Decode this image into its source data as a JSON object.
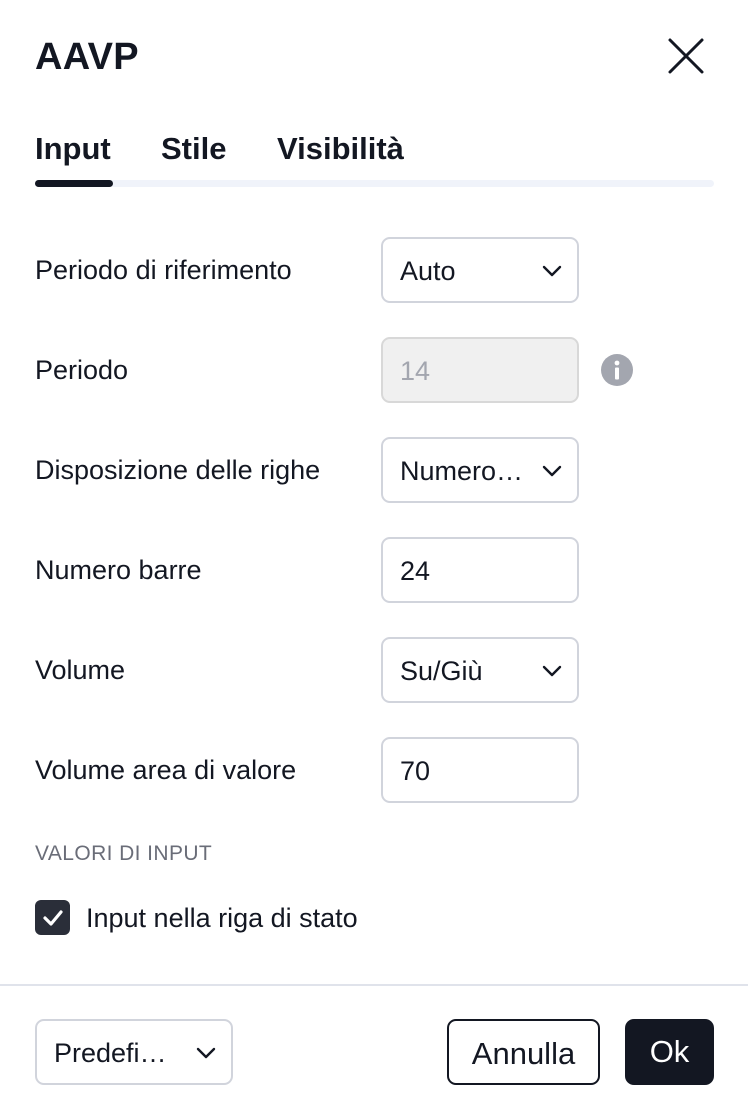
{
  "dialog": {
    "title": "AAVP"
  },
  "tabs": [
    {
      "label": "Input",
      "active": true
    },
    {
      "label": "Stile",
      "active": false
    },
    {
      "label": "Visibilità",
      "active": false
    }
  ],
  "fields": {
    "anchor_period": {
      "label": "Periodo di riferimento",
      "value": "Auto",
      "type": "select"
    },
    "length": {
      "label": "Periodo",
      "value": "14",
      "type": "input",
      "disabled": true
    },
    "rows_layout": {
      "label": "Disposizione delle righe",
      "value": "Numero…",
      "type": "select"
    },
    "row_size": {
      "label": "Numero barre",
      "value": "24",
      "type": "input"
    },
    "volume": {
      "label": "Volume",
      "value": "Su/Giù",
      "type": "select"
    },
    "value_area": {
      "label": "Volume area di valore",
      "value": "70",
      "type": "input"
    }
  },
  "section": {
    "input_values_label": "VALORI DI INPUT"
  },
  "checkbox": {
    "label": "Input nella riga di stato",
    "checked": true
  },
  "footer": {
    "preset_label": "Predefi…",
    "cancel_label": "Annulla",
    "ok_label": "Ok"
  },
  "icons": {
    "close": "close-icon",
    "info": "info-icon",
    "chevron": "chevron-down-icon",
    "check": "check-icon"
  },
  "colors": {
    "text": "#131722",
    "muted": "#6a6d78",
    "accent": "#131722",
    "border": "#d1d4dc",
    "disabled_bg": "#f0f0f0"
  }
}
